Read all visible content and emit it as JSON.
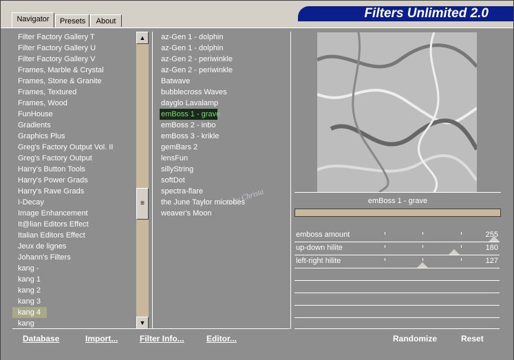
{
  "tabs": [
    {
      "label": "Navigator"
    },
    {
      "label": "Presets"
    },
    {
      "label": "About"
    }
  ],
  "app_title": "Filters Unlimited 2.0",
  "categories": [
    "Filter Factory Gallery T",
    "Filter Factory Gallery U",
    "Filter Factory Gallery V",
    "Frames, Marble & Crystal",
    "Frames, Stone & Granite",
    "Frames, Textured",
    "Frames, Wood",
    "FunHouse",
    "Gradients",
    "Graphics Plus",
    "Greg's Factory Output Vol. II",
    "Greg's Factory Output",
    "Harry's Button Tools",
    "Harry's Power Grads",
    "Harry's Rave Grads",
    "I-Decay",
    "Image Enhancement",
    "It@lian Editors Effect",
    "Italian Editors Effect",
    "Jeux de lignes",
    "Johann's Filters",
    "kang -",
    "kang 1",
    "kang 2",
    "kang 3",
    "kang 4",
    "kang"
  ],
  "filters": [
    "az-Gen 1  -  dolphin",
    "az-Gen 1  -  dolphin",
    "az-Gen 2  -  periwinkle",
    "az-Gen 2  -  periwinkle",
    "Batwave",
    "bubblecross Waves",
    "dayglo Lavalamp",
    "emBoss 1  -  grave",
    "emBoss 2  -  inbo",
    "emBoss 3  -  krikle",
    "gemBars 2",
    "lensFun",
    "sillyString",
    "softDot",
    "spectra-flare",
    "the June Taylor microbes",
    "weaver's Moon"
  ],
  "watermark": "© by Christa",
  "selected_filter": "emBoss 1  -  grave",
  "sliders": [
    {
      "label": "emboss amount",
      "value": "255",
      "level": 1.0
    },
    {
      "label": "up-down hilite",
      "value": "180",
      "level": 0.706
    },
    {
      "label": "left-right hilite",
      "value": "127",
      "level": 0.498
    }
  ],
  "buttons": {
    "database": "Database",
    "import": "Import...",
    "filter_info": "Filter Info...",
    "editor": "Editor...",
    "randomize": "Randomize",
    "reset": "Reset"
  },
  "colors": {
    "title_banner": "#0a1f8c",
    "panel": "#8e8e8e",
    "selection": "#1a2a1a",
    "highlight": "#a9a98a"
  }
}
